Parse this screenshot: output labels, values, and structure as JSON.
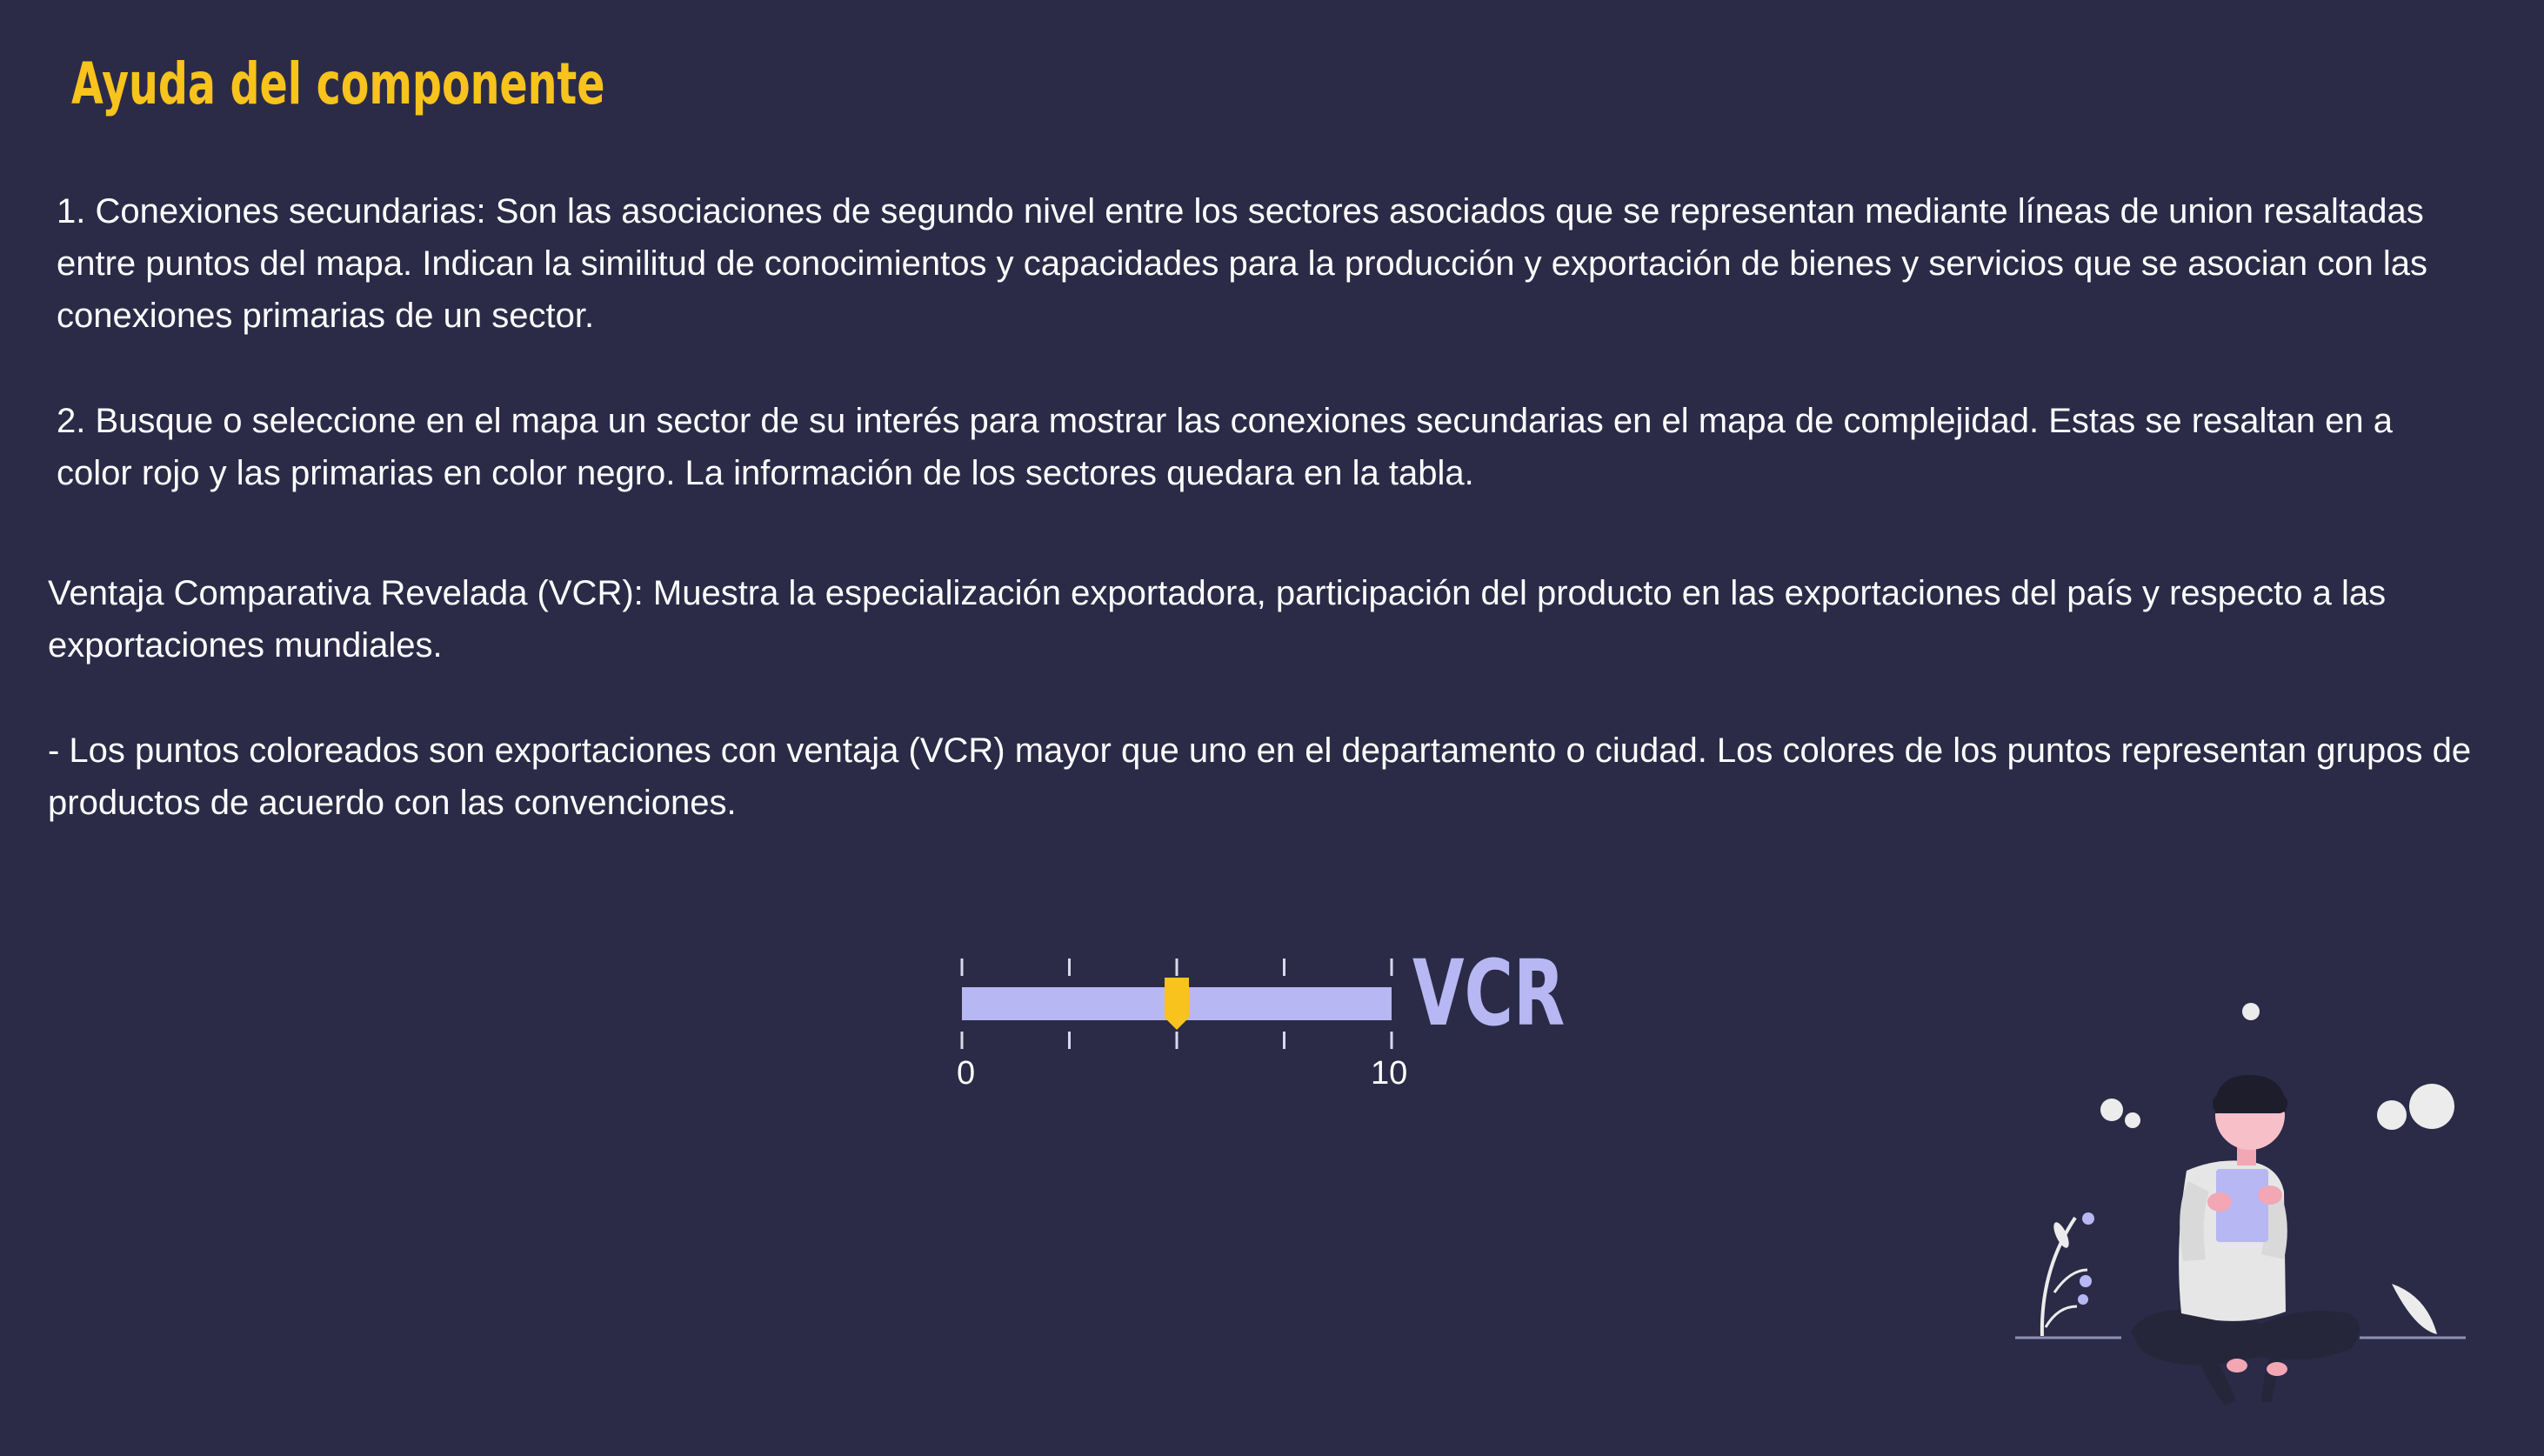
{
  "header": {
    "title": "Ayuda del componente"
  },
  "help": {
    "paragraph_1": "1. Conexiones secundarias: Son las asociaciones de segundo nivel entre los sectores asociados que se representan mediante líneas de union resaltadas entre puntos del mapa. Indican la similitud de conocimientos y capacidades para la producción y exportación de bienes y servicios que se asocian con las conexiones primarias de un sector.",
    "paragraph_2": "2. Busque o seleccione en el mapa un sector de su interés para mostrar las conexiones secundarias en el mapa de complejidad. Estas se resaltan en a color rojo y las primarias en color negro. La información de los sectores quedara en la tabla.",
    "paragraph_3": "Ventaja Comparativa Revelada (VCR): Muestra la especialización exportadora, participación del producto en las exportaciones del país y respecto a las exportaciones mundiales.",
    "paragraph_4": "- Los puntos coloreados son exportaciones con ventaja (VCR) mayor que uno en el departamento o ciudad. Los colores de los puntos representan grupos de productos de acuerdo con las convenciones."
  },
  "vcr_slider": {
    "label": "VCR",
    "min_label": "0",
    "max_label": "10",
    "min": 0,
    "max": 10,
    "value": 5,
    "tick_count": 5
  },
  "colors": {
    "background": "#2b2b48",
    "title": "#f7c31c",
    "text": "#ffffff",
    "slider_track": "#b7b7f3",
    "slider_handle": "#f7c31c",
    "tick": "#d9d9ee"
  },
  "illustration": {
    "icon": "person-reading-illustration"
  }
}
